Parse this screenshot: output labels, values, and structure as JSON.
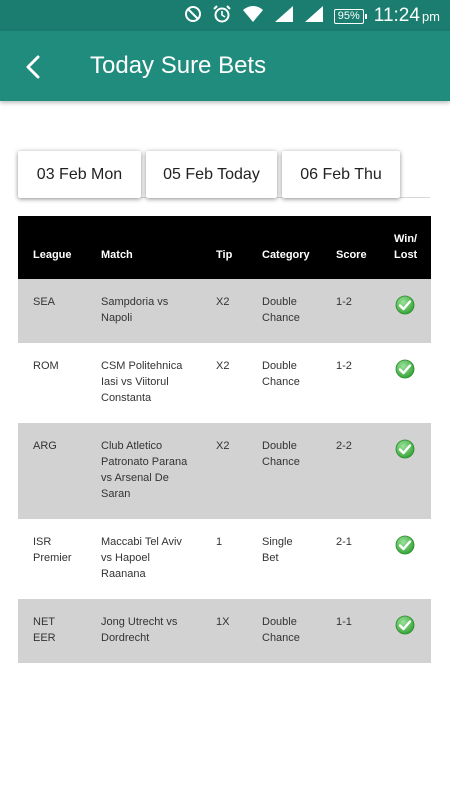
{
  "status_bar": {
    "battery": "95%",
    "time": "11:24",
    "ampm": "pm"
  },
  "app_bar": {
    "title": "Today Sure Bets",
    "back_icon": "back-arrow-icon"
  },
  "date_tabs": [
    {
      "label": "03 Feb Mon"
    },
    {
      "label": "05 Feb Today"
    },
    {
      "label": "06 Feb Thu"
    }
  ],
  "table": {
    "headers": {
      "league": "League",
      "match": "Match",
      "tip": "Tip",
      "category": "Category",
      "score": "Score",
      "result_line1": "Win/",
      "result_line2": "Lost"
    },
    "rows": [
      {
        "league": [
          "SEA"
        ],
        "match": [
          "Sampdoria vs",
          "Napoli"
        ],
        "tip": "X2",
        "category": [
          "Double",
          "Chance"
        ],
        "score": "1-2",
        "result": "win-check-icon"
      },
      {
        "league": [
          "ROM"
        ],
        "match": [
          "CSM Politehnica",
          "Iasi vs Viitorul",
          "Constanta"
        ],
        "tip": "X2",
        "category": [
          "Double",
          "Chance"
        ],
        "score": "1-2",
        "result": "win-check-icon"
      },
      {
        "league": [
          "ARG"
        ],
        "match": [
          "Club Atletico",
          "Patronato Parana",
          "vs Arsenal De",
          "Saran"
        ],
        "tip": "X2",
        "category": [
          "Double",
          "Chance"
        ],
        "score": "2-2",
        "result": "win-check-icon"
      },
      {
        "league": [
          "ISR",
          "Premier"
        ],
        "match": [
          "Maccabi Tel Aviv",
          "vs Hapoel",
          "Raanana"
        ],
        "tip": "1",
        "category": [
          "Single",
          "Bet"
        ],
        "score": "2-1",
        "result": "win-check-icon"
      },
      {
        "league": [
          "NET",
          "EER"
        ],
        "match": [
          "Jong Utrecht vs",
          "Dordrecht"
        ],
        "tip": "1X",
        "category": [
          "Double",
          "Chance"
        ],
        "score": "1-1",
        "result": "win-check-icon"
      }
    ]
  },
  "colors": {
    "status_bar": "#1a7d6f",
    "app_bar": "#208c7d",
    "header_bg": "#000000",
    "row_grey": "#d2d2d2",
    "check_green": "#3aa53a"
  }
}
